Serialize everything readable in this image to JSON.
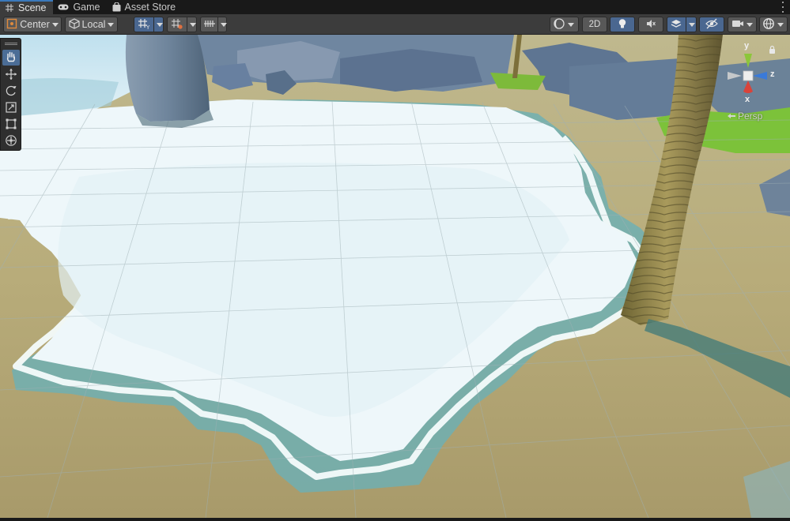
{
  "tabs": [
    {
      "label": "Scene",
      "icon": "grid-icon",
      "active": true
    },
    {
      "label": "Game",
      "icon": "gamepad-icon",
      "active": false
    },
    {
      "label": "Asset Store",
      "icon": "shopping-bag-icon",
      "active": false
    }
  ],
  "toolbar": {
    "pivot_label": "Center",
    "space_label": "Local",
    "mode_2d_label": "2D"
  },
  "gizmo": {
    "y_label": "y",
    "z_label": "z",
    "x_label": "x",
    "projection_label": "Persp"
  },
  "colors": {
    "accent_blue": "#4a6790",
    "tab_highlight": "#3a79bb",
    "axis_x": "#d9433a",
    "axis_y": "#8cc63a",
    "axis_z": "#3a7ad9"
  }
}
